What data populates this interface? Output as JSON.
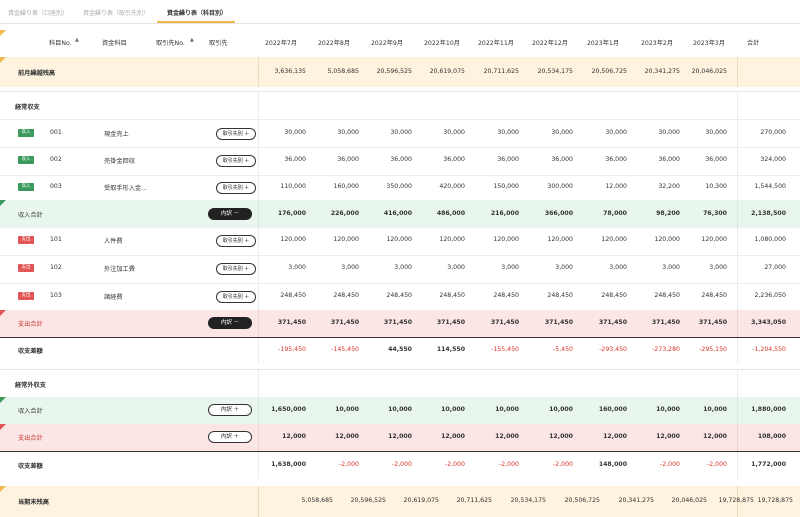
{
  "tabs": [
    {
      "label": "資金繰り表（口座別）"
    },
    {
      "label": "資金繰り表（取引先別）"
    },
    {
      "label": "資金繰り表（科目別）"
    }
  ],
  "header": {
    "account_no": "科目No.",
    "account_name": "資金科目",
    "partner_no": "取引先No.",
    "partner": "取引先",
    "months": [
      "2022年7月",
      "2022年8月",
      "2022年9月",
      "2022年10月",
      "2022年11月",
      "2022年12月",
      "2023年1月",
      "2023年2月",
      "2023年3月"
    ],
    "total": "合計",
    "sort_mark": "▲"
  },
  "opening": {
    "label": "前月繰越残高",
    "values": [
      "3,636,135",
      "5,058,685",
      "20,596,525",
      "20,619,075",
      "20,711,625",
      "20,534,175",
      "20,506,725",
      "20,341,275",
      "20,046,025"
    ],
    "total": ""
  },
  "ordinary": {
    "title": "経常収支",
    "income_rows": [
      {
        "badge": "収入",
        "no": "001",
        "name": "現金売上",
        "button": "取引先別 ＋",
        "values": [
          "30,000",
          "30,000",
          "30,000",
          "30,000",
          "30,000",
          "30,000",
          "30,000",
          "30,000",
          "30,000"
        ],
        "total": "270,000"
      },
      {
        "badge": "収入",
        "no": "002",
        "name": "売掛金回収",
        "button": "取引先別 ＋",
        "values": [
          "36,000",
          "36,000",
          "36,000",
          "36,000",
          "36,000",
          "36,000",
          "36,000",
          "36,000",
          "36,000"
        ],
        "total": "324,000"
      },
      {
        "badge": "収入",
        "no": "003",
        "name": "受取手形入金...",
        "button": "取引先別 ＋",
        "values": [
          "110,000",
          "160,000",
          "350,000",
          "420,000",
          "150,000",
          "300,000",
          "12,000",
          "32,200",
          "10,300"
        ],
        "total": "1,544,500"
      }
    ],
    "income_total": {
      "label": "収入合計",
      "button": "内訳 －",
      "values": [
        "176,000",
        "226,000",
        "416,000",
        "486,000",
        "216,000",
        "366,000",
        "78,000",
        "98,200",
        "76,300"
      ],
      "total": "2,138,500"
    },
    "expense_rows": [
      {
        "badge": "支出",
        "no": "101",
        "name": "人件費",
        "button": "取引先別 ＋",
        "values": [
          "120,000",
          "120,000",
          "120,000",
          "120,000",
          "120,000",
          "120,000",
          "120,000",
          "120,000",
          "120,000"
        ],
        "total": "1,080,000"
      },
      {
        "badge": "支出",
        "no": "102",
        "name": "外注加工費",
        "button": "取引先別 ＋",
        "values": [
          "3,000",
          "3,000",
          "3,000",
          "3,000",
          "3,000",
          "3,000",
          "3,000",
          "3,000",
          "3,000"
        ],
        "total": "27,000"
      },
      {
        "badge": "支出",
        "no": "103",
        "name": "諸経費",
        "button": "取引先別 ＋",
        "values": [
          "248,450",
          "248,450",
          "248,450",
          "248,450",
          "248,450",
          "248,450",
          "248,450",
          "248,450",
          "248,450"
        ],
        "total": "2,236,050"
      }
    ],
    "expense_total": {
      "label": "支出合計",
      "button": "内訳 －",
      "values": [
        "371,450",
        "371,450",
        "371,450",
        "371,450",
        "371,450",
        "371,450",
        "371,450",
        "371,450",
        "371,450"
      ],
      "total": "3,343,050"
    },
    "balance": {
      "label": "収支差額",
      "values": [
        "-195,450",
        "-145,450",
        "44,550",
        "114,550",
        "-155,450",
        "-5,450",
        "-293,450",
        "-273,280",
        "-295,150"
      ],
      "total": "-1,204,550"
    }
  },
  "non_ordinary": {
    "title": "経常外収支",
    "income_total": {
      "label": "収入合計",
      "button": "内訳 ＋",
      "values": [
        "1,650,000",
        "10,000",
        "10,000",
        "10,000",
        "10,000",
        "10,000",
        "160,000",
        "10,000",
        "10,000"
      ],
      "total": "1,880,000"
    },
    "expense_total": {
      "label": "支出合計",
      "button": "内訳 ＋",
      "values": [
        "12,000",
        "12,000",
        "12,000",
        "12,000",
        "12,000",
        "12,000",
        "12,000",
        "12,000",
        "12,000"
      ],
      "total": "108,000"
    },
    "balance": {
      "label": "収支差額",
      "values": [
        "1,638,000",
        "-2,000",
        "-2,000",
        "-2,000",
        "-2,000",
        "-2,000",
        "148,000",
        "-2,000",
        "-2,000"
      ],
      "total": "1,772,000"
    }
  },
  "closing": {
    "label": "当期末残高",
    "values": [
      "5,058,685",
      "20,596,525",
      "20,619,075",
      "20,711,625",
      "20,534,175",
      "20,506,725",
      "20,341,275",
      "20,046,025",
      "19,728,875"
    ],
    "total": "19,728,875"
  },
  "colors": {
    "yellow": "#fdf3df",
    "green": "#e9f6ee",
    "red": "#fbe5e5",
    "accent": "#f0b84a",
    "green_corner": "#3a9a5c",
    "red_corner": "#e15555"
  }
}
